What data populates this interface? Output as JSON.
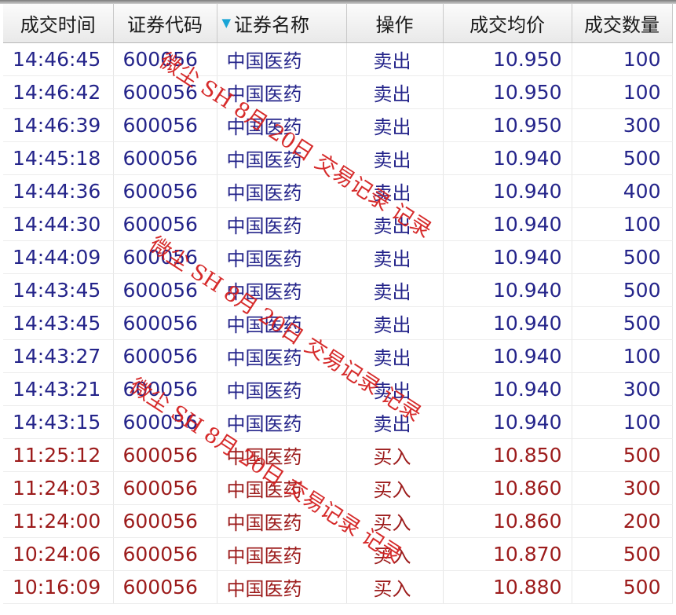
{
  "table": {
    "columns": [
      "成交时间",
      "证券代码",
      "证券名称",
      "操作",
      "成交均价",
      "成交数量"
    ],
    "sorted_column": "证券名称",
    "rows": [
      {
        "time": "14:46:45",
        "code": "600056",
        "name": "中国医药",
        "op": "卖出",
        "price": "10.950",
        "qty": "100",
        "side": "sell"
      },
      {
        "time": "14:46:42",
        "code": "600056",
        "name": "中国医药",
        "op": "卖出",
        "price": "10.950",
        "qty": "100",
        "side": "sell"
      },
      {
        "time": "14:46:39",
        "code": "600056",
        "name": "中国医药",
        "op": "卖出",
        "price": "10.950",
        "qty": "300",
        "side": "sell"
      },
      {
        "time": "14:45:18",
        "code": "600056",
        "name": "中国医药",
        "op": "卖出",
        "price": "10.940",
        "qty": "500",
        "side": "sell"
      },
      {
        "time": "14:44:36",
        "code": "600056",
        "name": "中国医药",
        "op": "卖出",
        "price": "10.940",
        "qty": "400",
        "side": "sell"
      },
      {
        "time": "14:44:30",
        "code": "600056",
        "name": "中国医药",
        "op": "卖出",
        "price": "10.940",
        "qty": "100",
        "side": "sell"
      },
      {
        "time": "14:44:09",
        "code": "600056",
        "name": "中国医药",
        "op": "卖出",
        "price": "10.940",
        "qty": "500",
        "side": "sell"
      },
      {
        "time": "14:43:45",
        "code": "600056",
        "name": "中国医药",
        "op": "卖出",
        "price": "10.940",
        "qty": "500",
        "side": "sell"
      },
      {
        "time": "14:43:45",
        "code": "600056",
        "name": "中国医药",
        "op": "卖出",
        "price": "10.940",
        "qty": "500",
        "side": "sell"
      },
      {
        "time": "14:43:27",
        "code": "600056",
        "name": "中国医药",
        "op": "卖出",
        "price": "10.940",
        "qty": "100",
        "side": "sell"
      },
      {
        "time": "14:43:21",
        "code": "600056",
        "name": "中国医药",
        "op": "卖出",
        "price": "10.940",
        "qty": "300",
        "side": "sell"
      },
      {
        "time": "14:43:15",
        "code": "600056",
        "name": "中国医药",
        "op": "卖出",
        "price": "10.940",
        "qty": "100",
        "side": "sell"
      },
      {
        "time": "11:25:12",
        "code": "600056",
        "name": "中国医药",
        "op": "买入",
        "price": "10.850",
        "qty": "500",
        "side": "buy"
      },
      {
        "time": "11:24:03",
        "code": "600056",
        "name": "中国医药",
        "op": "买入",
        "price": "10.860",
        "qty": "300",
        "side": "buy"
      },
      {
        "time": "11:24:00",
        "code": "600056",
        "name": "中国医药",
        "op": "买入",
        "price": "10.860",
        "qty": "200",
        "side": "buy"
      },
      {
        "time": "10:24:06",
        "code": "600056",
        "name": "中国医药",
        "op": "买入",
        "price": "10.870",
        "qty": "500",
        "side": "buy"
      },
      {
        "time": "10:16:09",
        "code": "600056",
        "name": "中国医药",
        "op": "买入",
        "price": "10.880",
        "qty": "500",
        "side": "buy"
      }
    ]
  },
  "colors": {
    "sell_text": "#24248a",
    "buy_text": "#9c1b1b",
    "watermark": "#d42020",
    "sort_indicator": "#1aa5d6"
  },
  "icons": {
    "sort": "sort-descending-triangle-icon"
  },
  "watermarks": [
    "微尘 SH 8月 20日 交易记录 记录",
    "微尘 SH 8月 20日 交易记录 记录",
    "微尘 SH 8月 20日 交易记录 记录"
  ]
}
